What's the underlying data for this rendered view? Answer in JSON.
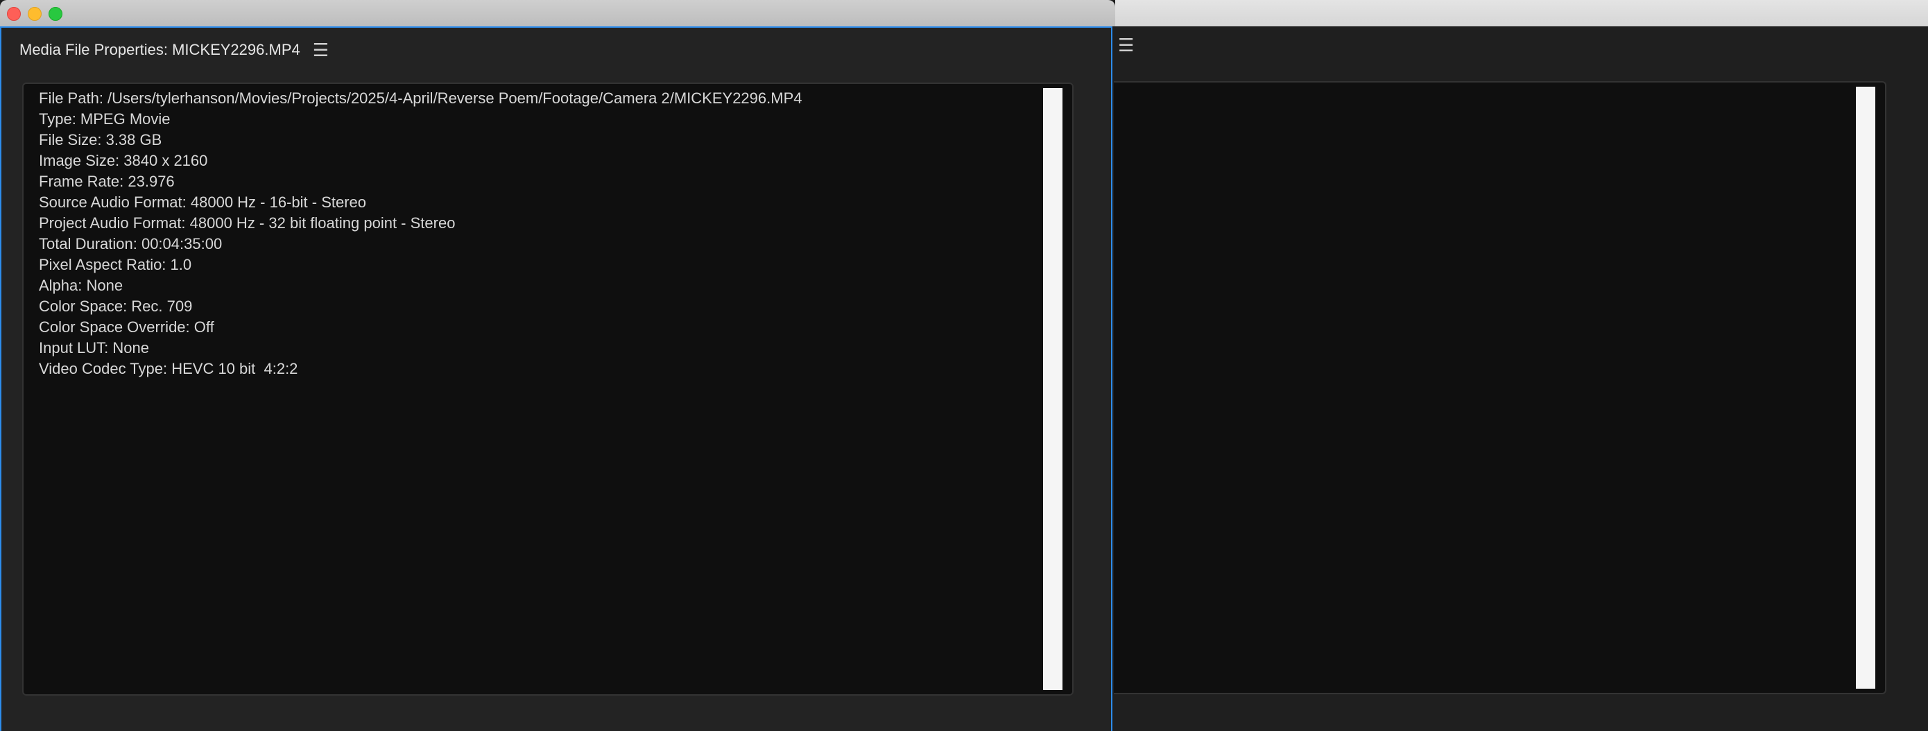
{
  "window": {
    "controls": [
      "close-icon",
      "minimize-icon",
      "zoom-icon"
    ]
  },
  "panel": {
    "title": "Media File Properties: MICKEY2296.MP4",
    "menu_icon": "☰"
  },
  "properties": [
    "File Path: /Users/tylerhanson/Movies/Projects/2025/4-April/Reverse Poem/Footage/Camera 2/MICKEY2296.MP4",
    "Type: MPEG Movie",
    "File Size: 3.38 GB",
    "Image Size: 3840 x 2160",
    "Frame Rate: 23.976",
    "Source Audio Format: 48000 Hz - 16-bit - Stereo",
    "Project Audio Format: 48000 Hz - 32 bit floating point - Stereo",
    "Total Duration: 00:04:35:00",
    "Pixel Aspect Ratio: 1.0",
    "Alpha: None",
    "Color Space: Rec. 709",
    "Color Space Override: Off",
    "Input LUT: None",
    "Video Codec Type: HEVC 10 bit  4:2:2"
  ],
  "colors": {
    "accent": "#2d8ceb",
    "panel_bg": "#232323",
    "content_bg": "#0f0f0f",
    "text": "#d8d8d8"
  }
}
